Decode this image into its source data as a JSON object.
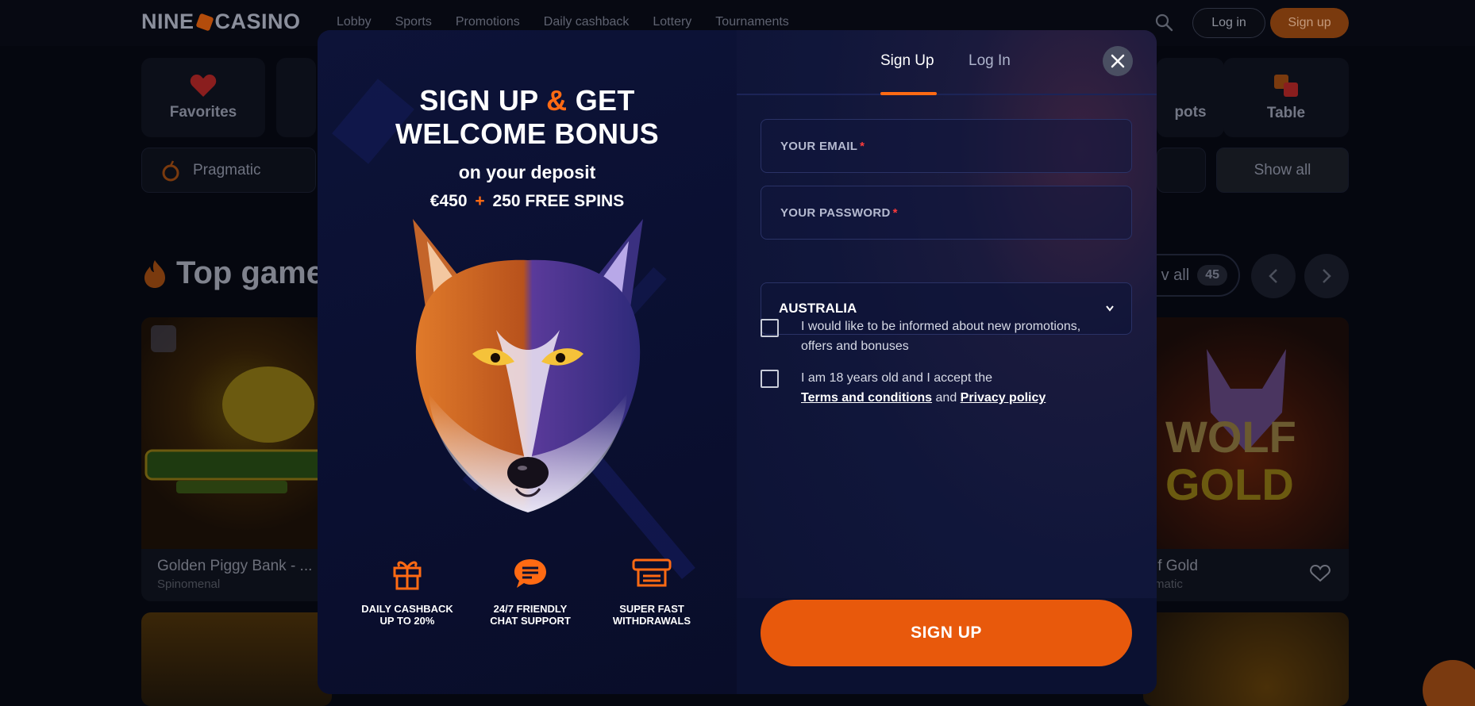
{
  "site": {
    "logo_left": "NINE",
    "logo_right": "CASINO",
    "nav": [
      "Lobby",
      "Sports",
      "Promotions",
      "Daily cashback",
      "Lottery",
      "Tournaments"
    ],
    "login_label": "Log in",
    "signup_label": "Sign up",
    "categories": {
      "favorites": "Favorites",
      "jackpots_partial": "pots",
      "table": "Table"
    },
    "provider": "Pragmatic",
    "show_all": "Show all",
    "section_title_partial": "Top game",
    "view_all_partial": "v all",
    "view_all_count": "45",
    "games": [
      {
        "name": "Golden Piggy Bank - ...",
        "provider": "Spinomenal"
      },
      {
        "name": "lf Gold",
        "provider": "matic"
      }
    ]
  },
  "modal": {
    "promo": {
      "title_line1_a": "SIGN UP",
      "title_amp": "&",
      "title_line1_b": "GET",
      "title_line2": "WELCOME BONUS",
      "subtitle": "on your deposit",
      "offer_amount": "€450",
      "offer_plus": "+",
      "offer_spins": "250 FREE SPINS"
    },
    "features": [
      {
        "icon": "gift-icon",
        "line1": "DAILY CASHBACK",
        "line2": "UP TO 20%"
      },
      {
        "icon": "chat-icon",
        "line1": "24/7 FRIENDLY",
        "line2": "CHAT SUPPORT"
      },
      {
        "icon": "wallet-icon",
        "line1": "SUPER FAST",
        "line2": "WITHDRAWALS"
      }
    ],
    "tabs": {
      "signup": "Sign Up",
      "login": "Log In"
    },
    "form": {
      "email_placeholder": "YOUR EMAIL",
      "password_placeholder": "YOUR PASSWORD",
      "required_mark": "*",
      "country": "AUSTRALIA",
      "promo_consent_line1": "I would like to be informed about new promotions,",
      "promo_consent_line2": "offers and bonuses",
      "age_consent": "I am 18 years old and I accept the",
      "terms_link": "Terms and conditions",
      "and_text": "and",
      "privacy_link": "Privacy policy",
      "submit_label": "SIGN UP"
    },
    "colors": {
      "accent": "#ff6a13",
      "button": "#e8590c",
      "panel": "#0b1030"
    }
  }
}
